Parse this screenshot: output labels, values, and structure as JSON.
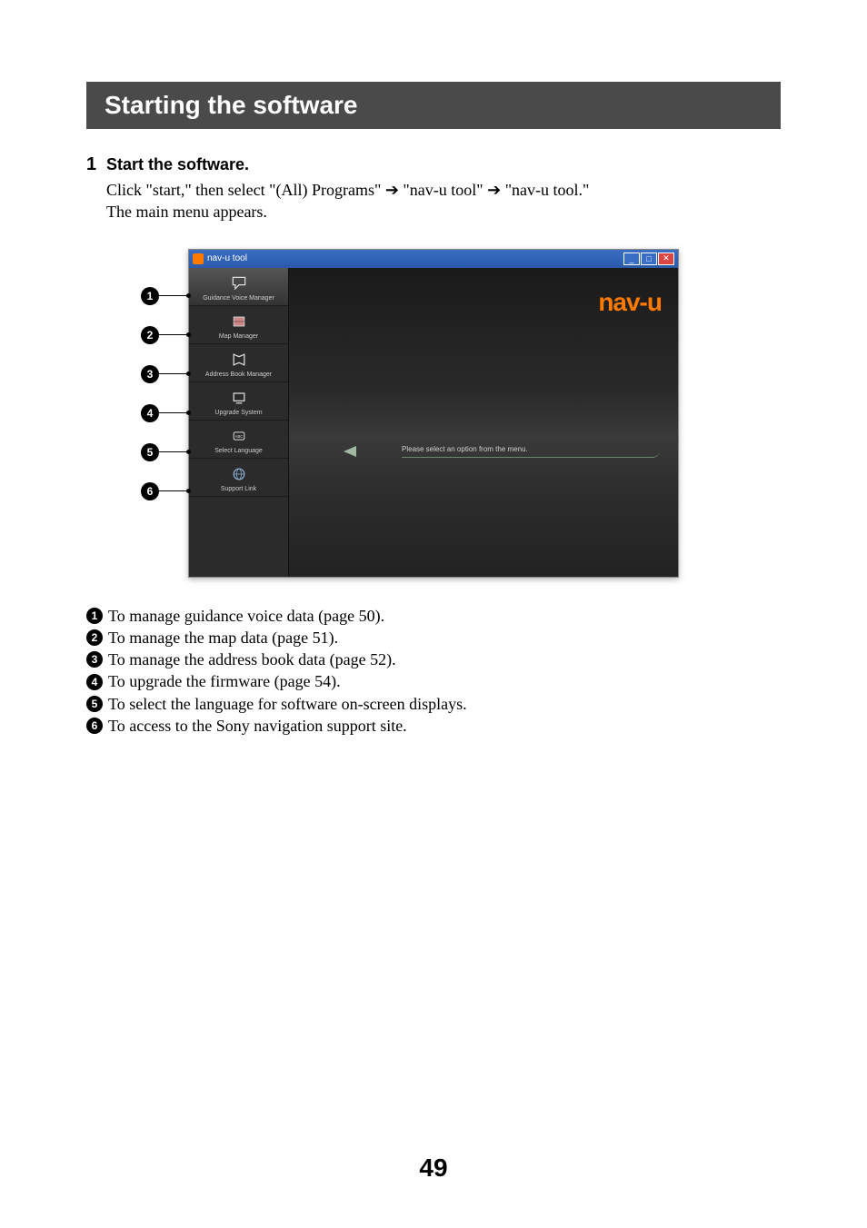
{
  "section_title": "Starting the software",
  "step": {
    "num": "1",
    "title": "Start the software.",
    "line1_a": "Click \"start,\" then select \"(All) Programs\" ",
    "line1_b": " \"nav-u tool\" ",
    "line1_c": " \"nav-u tool.\"",
    "line2": "The main menu appears."
  },
  "window": {
    "title": "nav-u tool",
    "brand": "nav-u",
    "prompt": "Please select an option from the menu.",
    "menu": [
      {
        "label": "Guidance Voice Manager"
      },
      {
        "label": "Map Manager"
      },
      {
        "label": "Address Book Manager"
      },
      {
        "label": "Upgrade System"
      },
      {
        "label": "Select Language"
      },
      {
        "label": "Support Link"
      }
    ]
  },
  "callouts": [
    "1",
    "2",
    "3",
    "4",
    "5",
    "6"
  ],
  "legend": [
    "To manage guidance voice data (page 50).",
    "To manage the map data (page 51).",
    "To manage the address book data (page 52).",
    "To upgrade the firmware (page 54).",
    "To select the language for software on-screen displays.",
    "To access to the Sony navigation support site."
  ],
  "arrow_glyph": "➔",
  "page_number": "49"
}
